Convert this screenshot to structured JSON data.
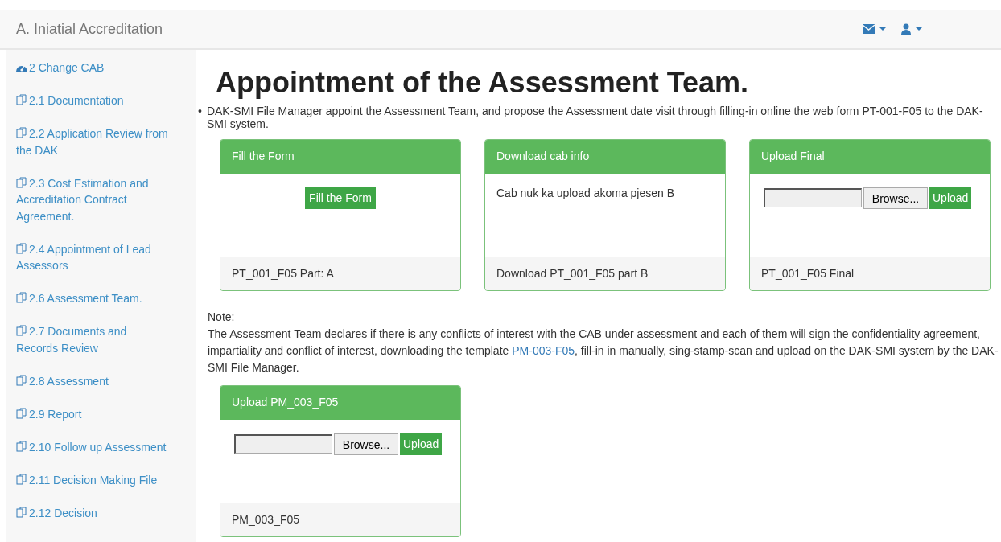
{
  "navbar": {
    "title": "A. Iniatial Accreditation"
  },
  "sidebar": {
    "items": [
      {
        "kind": "dashboard",
        "label": "2 Change CAB"
      },
      {
        "kind": "copy",
        "label": "2.1 Documentation"
      },
      {
        "kind": "copy",
        "label": "2.2 Application Review from the DAK"
      },
      {
        "kind": "copy",
        "label": "2.3 Cost Estimation and Accreditation Contract Agreement."
      },
      {
        "kind": "copy",
        "label": "2.4 Appointment of Lead Assessors"
      },
      {
        "kind": "copy",
        "label": "2.6 Assessment Team."
      },
      {
        "kind": "copy",
        "label": "2.7 Documents and Records Review"
      },
      {
        "kind": "copy",
        "label": "2.8 Assessment"
      },
      {
        "kind": "copy",
        "label": "2.9 Report"
      },
      {
        "kind": "copy",
        "label": "2.10 Follow up Assessment"
      },
      {
        "kind": "copy",
        "label": "2.11 Decision Making File"
      },
      {
        "kind": "copy",
        "label": "2.12 Decision"
      }
    ]
  },
  "main": {
    "heading": "Appointment of the Assessment Team.",
    "bullet": "•",
    "intro": "DAK-SMI File Manager appoint the Assessment Team, and propose the Assessment date visit through filling-in online the web form PT-001-F05 to the DAK-SMI system.",
    "cards": [
      {
        "kind": "button",
        "title": "Fill the Form",
        "button": "Fill the Form",
        "footer": "PT_001_F05 Part: A"
      },
      {
        "kind": "text",
        "title": "Download cab info",
        "text": "Cab nuk ka upload akoma pjesen B",
        "footer": "Download PT_001_F05 part B"
      },
      {
        "kind": "upload",
        "title": "Upload Final",
        "browse": "Browse...",
        "button": "Upload",
        "footer": "PT_001_F05 Final"
      }
    ],
    "note": {
      "label": "Note:",
      "text_before": "The Assessment Team declares if there is any conflicts of interest with the CAB under assessment and each of them will sign the confidentiality agreement, impartiality and conflict of interest, downloading the template ",
      "link": "PM-003-F05",
      "text_after": ", fill-in in manually, sing-stamp-scan and upload on the DAK-SMI system by the DAK-SMI File Manager."
    },
    "cards2": [
      {
        "kind": "upload",
        "title": "Upload PM_003_F05",
        "browse": "Browse...",
        "button": "Upload",
        "footer": "PM_003_F05"
      }
    ]
  }
}
